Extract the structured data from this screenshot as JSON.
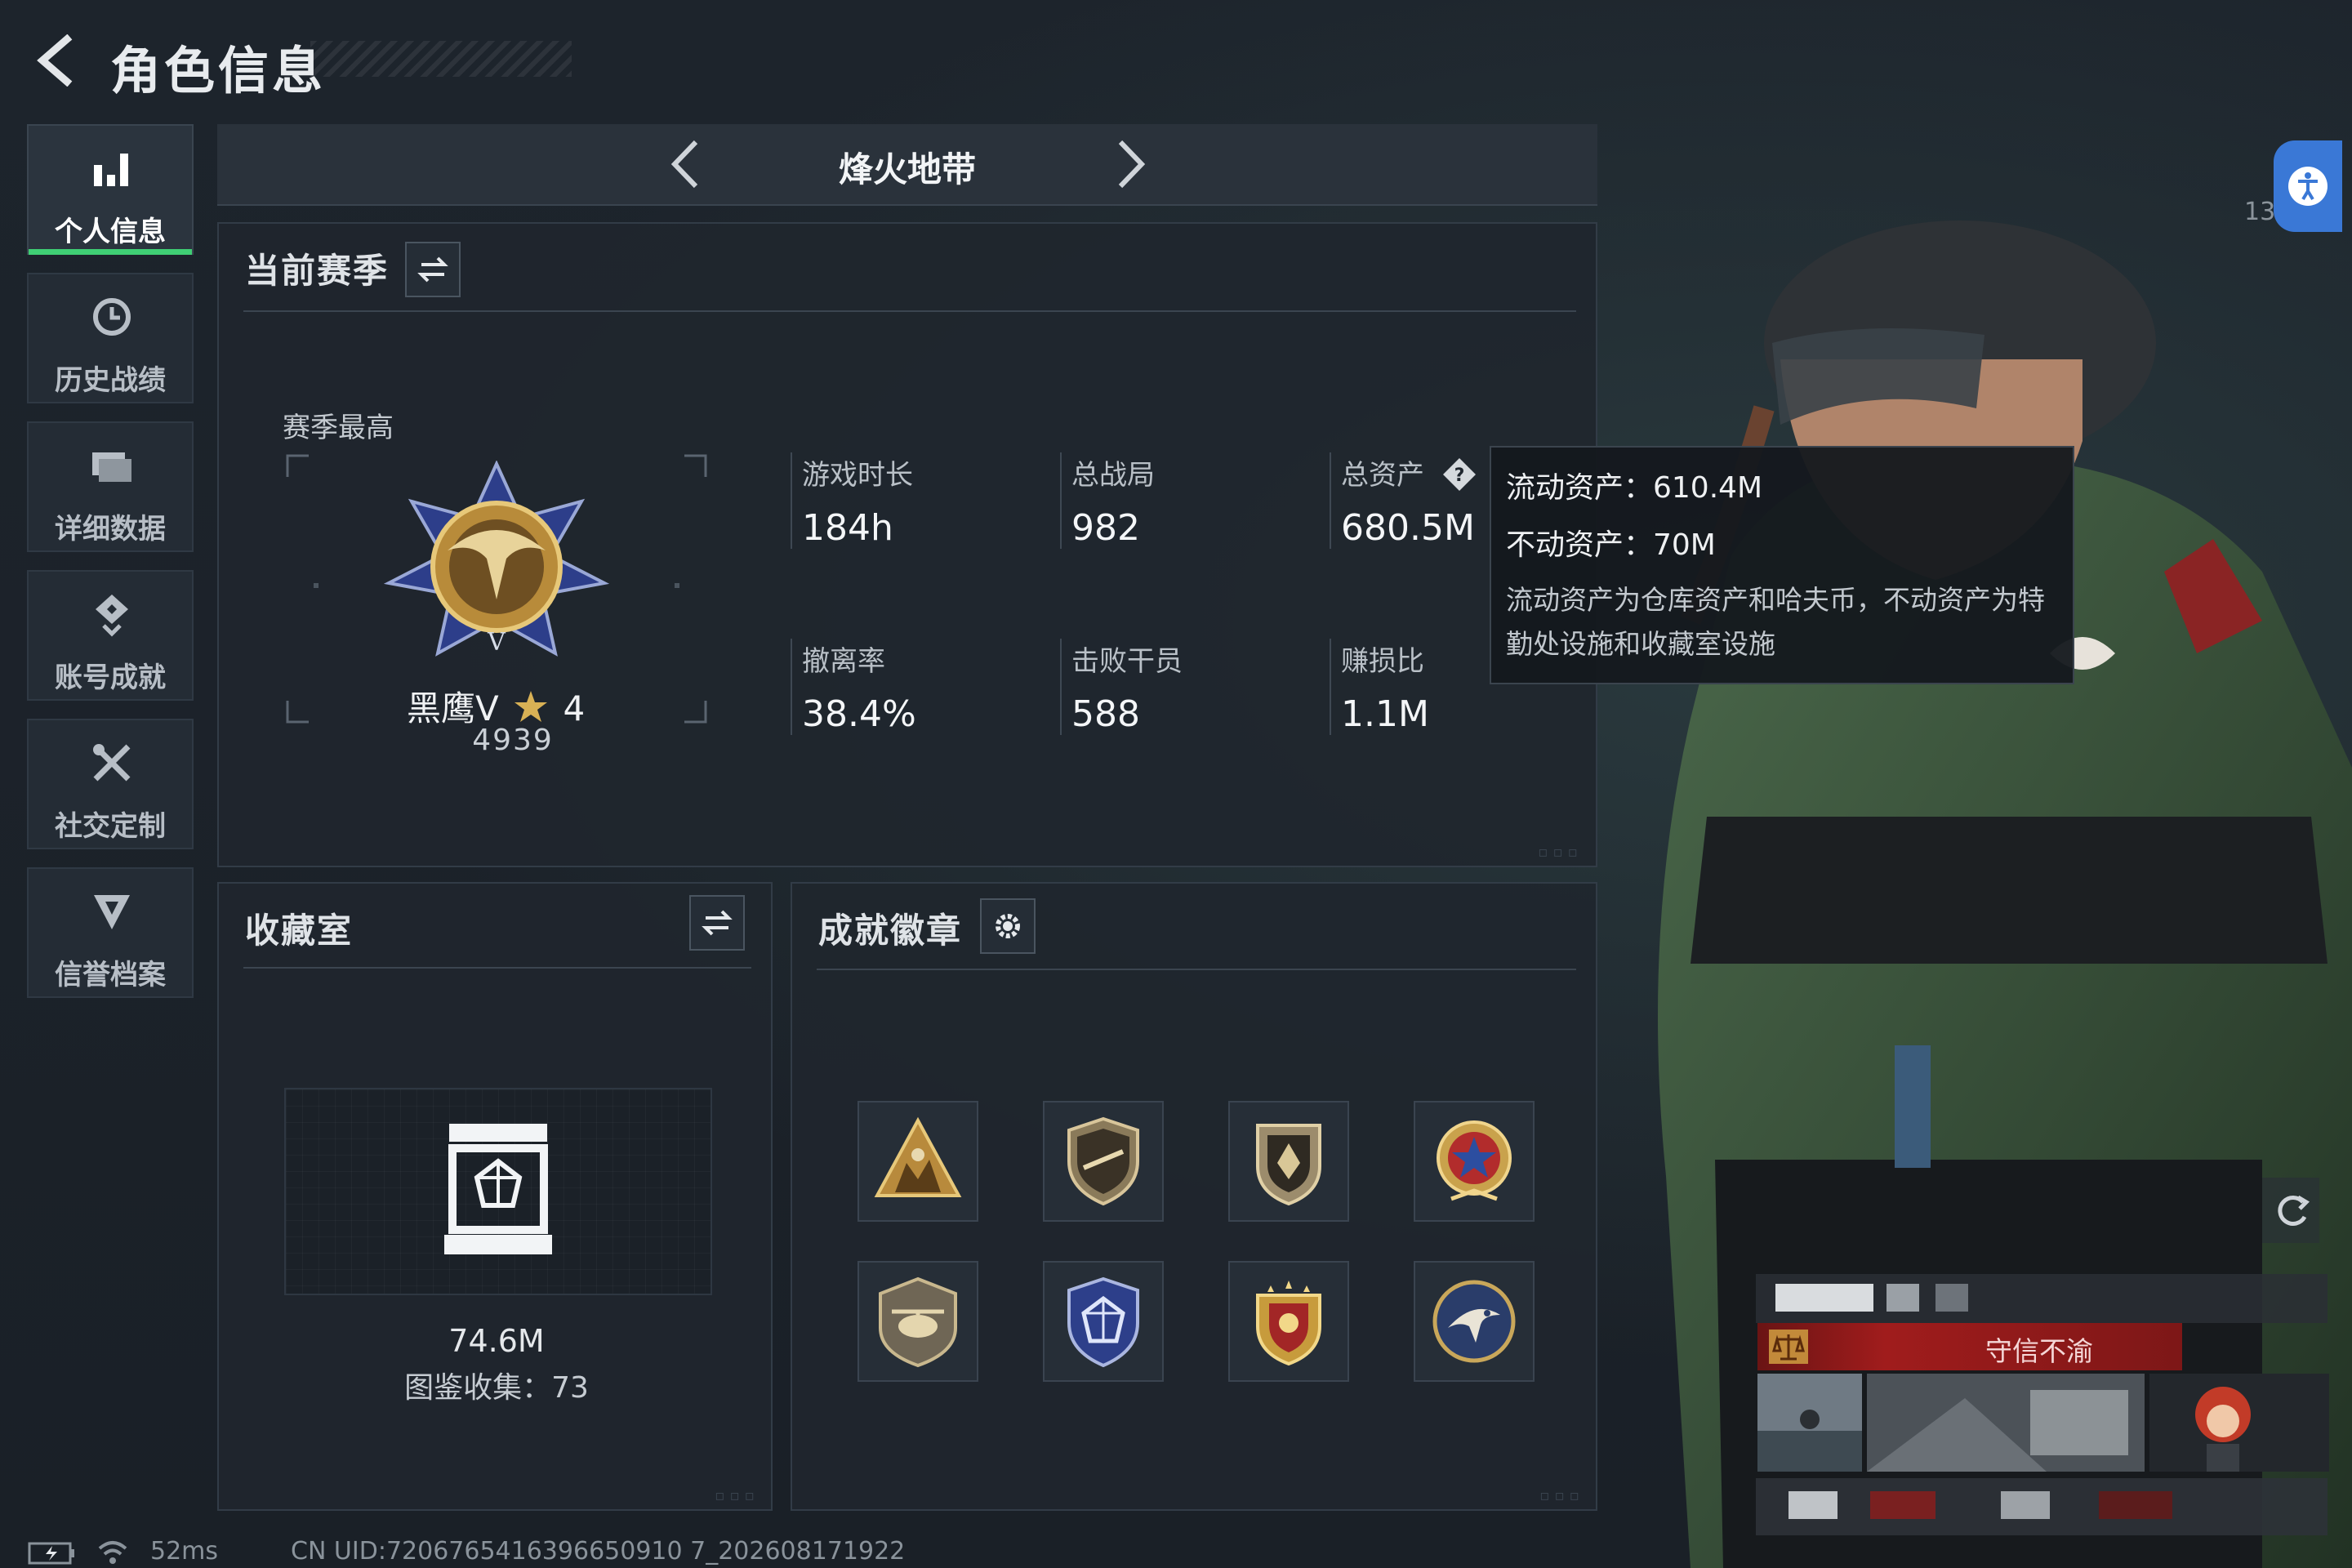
{
  "header": {
    "title": "角色信息"
  },
  "sidebar": {
    "items": [
      {
        "label": "个人信息",
        "icon": "bar-chart-icon",
        "active": true
      },
      {
        "label": "历史战绩",
        "icon": "history-icon"
      },
      {
        "label": "详细数据",
        "icon": "folder-icon"
      },
      {
        "label": "账号成就",
        "icon": "medal-icon"
      },
      {
        "label": "社交定制",
        "icon": "tools-icon"
      },
      {
        "label": "信誉档案",
        "icon": "shield-down-icon"
      }
    ]
  },
  "mode": {
    "title": "烽火地带"
  },
  "season": {
    "title": "当前赛季",
    "best_label": "赛季最高",
    "rank_name": "黑鹰V",
    "rank_stars": "4",
    "rank_score": "4939",
    "stats": [
      {
        "label": "游戏时长",
        "value": "184h"
      },
      {
        "label": "总战局",
        "value": "982"
      },
      {
        "label": "总资产",
        "value": "680.5M"
      },
      {
        "label": "撤离率",
        "value": "38.4%"
      },
      {
        "label": "击败干员",
        "value": "588"
      },
      {
        "label": "赚损比",
        "value": "1.1M"
      }
    ]
  },
  "tooltip": {
    "liquid": "流动资产：610.4M",
    "fixed": "不动资产：70M",
    "desc": "流动资产为仓库资产和哈夫币，不动资产为特勤处设施和收藏室设施"
  },
  "collection": {
    "title": "收藏室",
    "value": "74.6M",
    "count": "图鉴收集：73"
  },
  "badges": {
    "title": "成就徽章",
    "items": [
      "soldiers-badge-icon",
      "rifle-shield-badge-icon",
      "wing-shield-badge-icon",
      "star-wreath-badge-icon",
      "helicopter-badge-icon",
      "crystal-shield-badge-icon",
      "gold-stars-badge-icon",
      "eagle-badge-icon"
    ]
  },
  "profile": {
    "motto": "守信不渝",
    "like_count": "13"
  },
  "status": {
    "ping": "52ms",
    "uid": "CN UID:7206765416396650910 7_202608171922"
  },
  "colors": {
    "accent_green": "#3fcf74",
    "motto_red": "#a01c1c",
    "access_blue": "#3a78d6"
  }
}
